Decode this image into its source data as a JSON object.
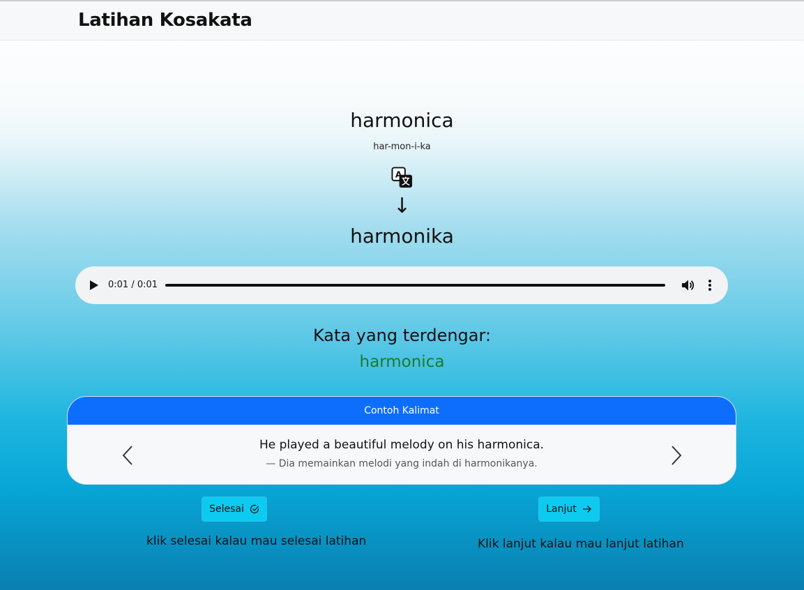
{
  "app": {
    "title": "Latihan Kosakata"
  },
  "word": {
    "english": "harmonica",
    "syllables": "har-mon-i-ka",
    "arrow": "↓",
    "indonesian": "harmonika"
  },
  "icons": {
    "translate": "translate-icon",
    "play": "play-icon",
    "volume": "volume-icon",
    "menu": "more-vert-icon",
    "prev": "chevron-left-icon",
    "next": "chevron-right-icon",
    "check": "check-circle-icon",
    "arrow_right": "arrow-right-icon"
  },
  "audio": {
    "time": "0:01 / 0:01",
    "progress": 1.0
  },
  "heard": {
    "label": "Kata yang terdengar:",
    "word": "harmonica"
  },
  "example": {
    "header": "Contoh Kalimat",
    "sentence_en": "He played a beautiful melody on his harmonica.",
    "sentence_id": "—  Dia memainkan melodi yang indah di harmonikanya."
  },
  "actions": {
    "finish_label": "Selesai",
    "next_label": "Lanjut",
    "finish_hint": "klik selesai kalau mau selesai latihan",
    "next_hint": "Klik lanjut kalau mau lanjut latihan"
  },
  "colors": {
    "card_header": "#0d6efd",
    "button": "#0dcaf0",
    "heard_word": "#1c7a2c"
  }
}
